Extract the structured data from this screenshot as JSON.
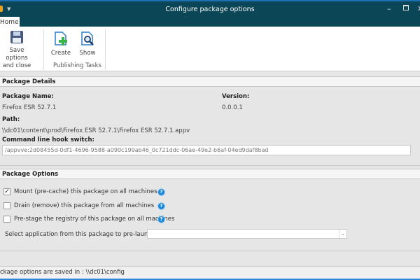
{
  "window": {
    "title": "Configure package options",
    "minimize_icon": "minimize-icon",
    "maximize_icon": "maximize-icon",
    "close_icon": "close-icon"
  },
  "ribbon": {
    "tab": "Home",
    "save_label_1": "Save options",
    "save_label_2": "and close",
    "create_label": "Create",
    "show_label": "Show",
    "group_label": "Publishing Tasks"
  },
  "details": {
    "header": "Package Details",
    "name_label": "Package Name:",
    "name_value": "Firefox ESR 52.7.1",
    "version_label": "Version:",
    "version_value": "0.0.0.1",
    "path_label": "Path:",
    "path_value": "\\\\dc01\\content\\prod\\Firefox ESR 52.7.1\\Firefox ESR 52.7.1.appv",
    "hook_label": "Command line hook switch:",
    "hook_value": "/appvve:2d08455d-0df1-4696-9588-a090c199ab46_0c721ddc-06ae-49e2-b6af-04ed9daf8bad"
  },
  "options": {
    "header": "Package Options",
    "items": [
      {
        "label": "Mount (pre-cache) this package on all machines",
        "checked": true
      },
      {
        "label": "Drain (remove) this package from all machines",
        "checked": false
      },
      {
        "label": "Pre-stage the registry of this package on all machines",
        "checked": false
      }
    ],
    "prelaunch_label": "Select application from this package to pre-launch:",
    "prelaunch_value": ""
  },
  "status": {
    "text": "ckage options are saved in : \\\\dc01\\config"
  }
}
